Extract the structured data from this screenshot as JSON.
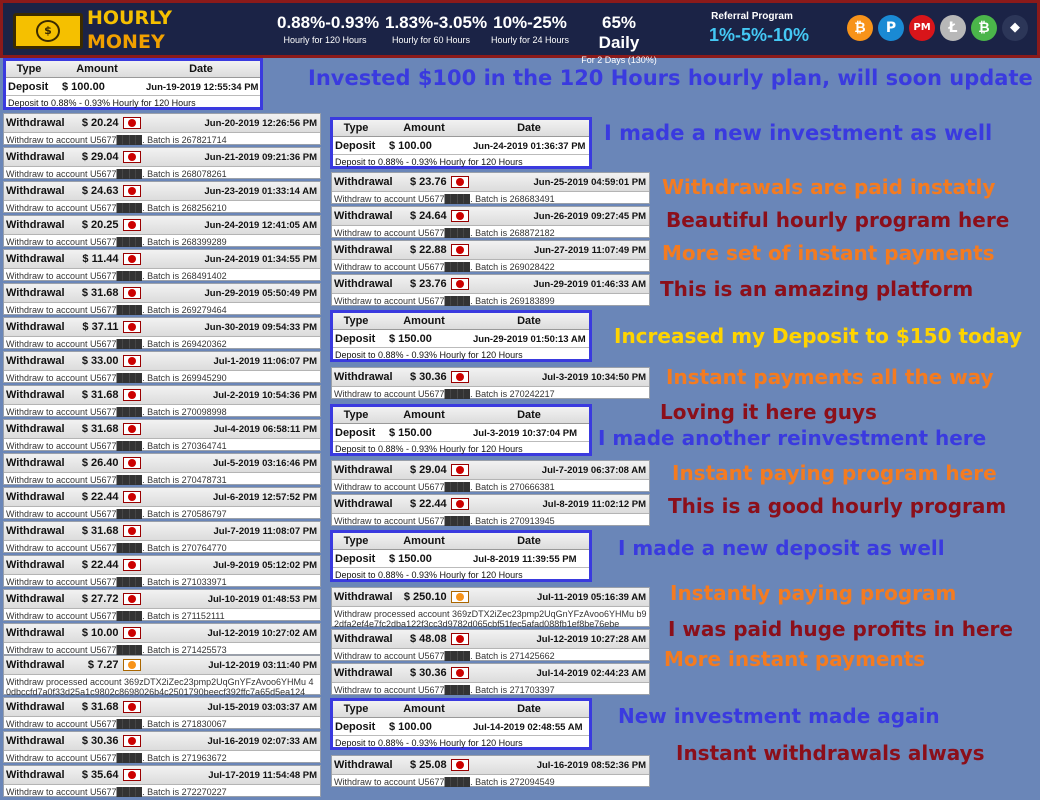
{
  "header": {
    "logo_top": "HOURLY",
    "logo_bottom": "MONEY",
    "rates": [
      {
        "range": "0.88%-0.93%",
        "sub": "Hourly for 120 Hours"
      },
      {
        "range": "1.83%-3.05%",
        "sub": "Hourly for 60 Hours"
      },
      {
        "range": "10%-25%",
        "sub": "Hourly for 24 Hours"
      },
      {
        "range": "65% Daily",
        "sub": "For 2 Days (130%)"
      }
    ],
    "referral_title": "Referral Program",
    "referral_value": "1%-5%-10%",
    "payment_icons": [
      "bitcoin-icon",
      "paypal-icon",
      "perfectmoney-icon",
      "litecoin-icon",
      "bitcoincash-icon",
      "ethereum-icon"
    ]
  },
  "col_headers": {
    "type": "Type",
    "amount": "Amount",
    "date": "Date"
  },
  "left_deposit": {
    "type": "Deposit",
    "amount": "$ 100.00",
    "date": "Jun-19-2019 12:55:34 PM",
    "detail": "Deposit to 0.88% - 0.93% Hourly for 120 Hours"
  },
  "left_records": [
    {
      "type": "Withdrawal",
      "amount": "$ 20.24",
      "date": "Jun-20-2019 12:26:56 PM",
      "detail": "Withdraw to account U5677████. Batch is 267821714"
    },
    {
      "type": "Withdrawal",
      "amount": "$ 29.04",
      "date": "Jun-21-2019 09:21:36 PM",
      "detail": "Withdraw to account U5677████. Batch is 268078261"
    },
    {
      "type": "Withdrawal",
      "amount": "$ 24.63",
      "date": "Jun-23-2019 01:33:14 AM",
      "detail": "Withdraw to account U5677████. Batch is 268256210"
    },
    {
      "type": "Withdrawal",
      "amount": "$ 20.25",
      "date": "Jun-24-2019 12:41:05 AM",
      "detail": "Withdraw to account U5677████. Batch is 268399289"
    },
    {
      "type": "Withdrawal",
      "amount": "$ 11.44",
      "date": "Jun-24-2019 01:34:55 PM",
      "detail": "Withdraw to account U5677████. Batch is 268491402"
    },
    {
      "type": "Withdrawal",
      "amount": "$ 31.68",
      "date": "Jun-29-2019 05:50:49 PM",
      "detail": "Withdraw to account U5677████. Batch is 269279464"
    },
    {
      "type": "Withdrawal",
      "amount": "$ 37.11",
      "date": "Jun-30-2019 09:54:33 PM",
      "detail": "Withdraw to account U5677████. Batch is 269420362"
    },
    {
      "type": "Withdrawal",
      "amount": "$ 33.00",
      "date": "Jul-1-2019 11:06:07 PM",
      "detail": "Withdraw to account U5677████. Batch is 269945290"
    },
    {
      "type": "Withdrawal",
      "amount": "$ 31.68",
      "date": "Jul-2-2019 10:54:36 PM",
      "detail": "Withdraw to account U5677████. Batch is 270098998"
    },
    {
      "type": "Withdrawal",
      "amount": "$ 31.68",
      "date": "Jul-4-2019 06:58:11 PM",
      "detail": "Withdraw to account U5677████. Batch is 270364741"
    },
    {
      "type": "Withdrawal",
      "amount": "$ 26.40",
      "date": "Jul-5-2019 03:16:46 PM",
      "detail": "Withdraw to account U5677████. Batch is 270478731"
    },
    {
      "type": "Withdrawal",
      "amount": "$ 22.44",
      "date": "Jul-6-2019 12:57:52 PM",
      "detail": "Withdraw to account U5677████. Batch is 270586797"
    },
    {
      "type": "Withdrawal",
      "amount": "$ 31.68",
      "date": "Jul-7-2019 11:08:07 PM",
      "detail": "Withdraw to account U5677████. Batch is 270764770"
    },
    {
      "type": "Withdrawal",
      "amount": "$ 22.44",
      "date": "Jul-9-2019 05:12:02 PM",
      "detail": "Withdraw to account U5677████. Batch is 271033971"
    },
    {
      "type": "Withdrawal",
      "amount": "$ 27.72",
      "date": "Jul-10-2019 01:48:53 PM",
      "detail": "Withdraw to account U5677████. Batch is 271152111"
    },
    {
      "type": "Withdrawal",
      "amount": "$ 10.00",
      "date": "Jul-12-2019 10:27:02 AM",
      "detail": "Withdraw to account U5677████. Batch is 271425573"
    },
    {
      "type": "Withdrawal",
      "amount": "$ 7.27",
      "date": "Jul-12-2019 03:11:40 PM",
      "detail": "Withdraw processed account 369zDTX2iZec23pmp2UqGnYFzAvoo6YHMu 40dbccfd7a0f33d25a1c9802c8698026b4c2501790beecf392ffc7a65d5ea124",
      "btc": true
    },
    {
      "type": "Withdrawal",
      "amount": "$ 31.68",
      "date": "Jul-15-2019 03:03:37 AM",
      "detail": "Withdraw to account U5677████. Batch is 271830067"
    },
    {
      "type": "Withdrawal",
      "amount": "$ 30.36",
      "date": "Jul-16-2019 02:07:33 AM",
      "detail": "Withdraw to account U5677████. Batch is 271963672"
    },
    {
      "type": "Withdrawal",
      "amount": "$ 35.64",
      "date": "Jul-17-2019 11:54:48 PM",
      "detail": "Withdraw to account U5677████. Batch is 272270227"
    }
  ],
  "right_deposits": [
    {
      "type": "Deposit",
      "amount": "$ 100.00",
      "date": "Jun-24-2019 01:36:37 PM",
      "detail": "Deposit to 0.88% - 0.93% Hourly for 120 Hours"
    },
    {
      "type": "Deposit",
      "amount": "$ 150.00",
      "date": "Jun-29-2019 01:50:13 AM",
      "detail": "Deposit to 0.88% - 0.93% Hourly for 120 Hours"
    },
    {
      "type": "Deposit",
      "amount": "$ 150.00",
      "date": "Jul-3-2019 10:37:04 PM",
      "detail": "Deposit to 0.88% - 0.93% Hourly for 120 Hours"
    },
    {
      "type": "Deposit",
      "amount": "$ 150.00",
      "date": "Jul-8-2019 11:39:55 PM",
      "detail": "Deposit to 0.88% - 0.93% Hourly for 120 Hours"
    },
    {
      "type": "Deposit",
      "amount": "$ 100.00",
      "date": "Jul-14-2019 02:48:55 AM",
      "detail": "Deposit to 0.88% - 0.93% Hourly for 120 Hours"
    }
  ],
  "right_records": [
    {
      "type": "Withdrawal",
      "amount": "$ 23.76",
      "date": "Jun-25-2019 04:59:01 PM",
      "detail": "Withdraw to account U5677████. Batch is 268683491"
    },
    {
      "type": "Withdrawal",
      "amount": "$ 24.64",
      "date": "Jun-26-2019 09:27:45 PM",
      "detail": "Withdraw to account U5677████. Batch is 268872182"
    },
    {
      "type": "Withdrawal",
      "amount": "$ 22.88",
      "date": "Jun-27-2019 11:07:49 PM",
      "detail": "Withdraw to account U5677████. Batch is 269028422"
    },
    {
      "type": "Withdrawal",
      "amount": "$ 23.76",
      "date": "Jun-29-2019 01:46:33 AM",
      "detail": "Withdraw to account U5677████. Batch is 269183899"
    },
    {
      "type": "Withdrawal",
      "amount": "$ 30.36",
      "date": "Jul-3-2019 10:34:50 PM",
      "detail": "Withdraw to account U5677████. Batch is 270242217"
    },
    {
      "type": "Withdrawal",
      "amount": "$ 29.04",
      "date": "Jul-7-2019 06:37:08 AM",
      "detail": "Withdraw to account U5677████. Batch is 270666381"
    },
    {
      "type": "Withdrawal",
      "amount": "$ 22.44",
      "date": "Jul-8-2019 11:02:12 PM",
      "detail": "Withdraw to account U5677████. Batch is 270913945"
    },
    {
      "type": "Withdrawal",
      "amount": "$ 250.10",
      "date": "Jul-11-2019 05:16:39 AM",
      "detail": "Withdraw processed account 369zDTX2iZec23pmp2UqGnYFzAvoo6YHMu b92dfa2ef4e7fc2dba122f3cc3d9782d065cbf51fec5afad088fb1ef8be76ebe",
      "btc": true
    },
    {
      "type": "Withdrawal",
      "amount": "$ 48.08",
      "date": "Jul-12-2019 10:27:28 AM",
      "detail": "Withdraw to account U5677████. Batch is 271425662"
    },
    {
      "type": "Withdrawal",
      "amount": "$ 30.36",
      "date": "Jul-14-2019 02:44:23 AM",
      "detail": "Withdraw to account U5677████. Batch is 271703397"
    },
    {
      "type": "Withdrawal",
      "amount": "$ 25.08",
      "date": "Jul-16-2019 08:52:36 PM",
      "detail": "Withdraw to account U5677████. Batch is 272094549"
    }
  ],
  "captions": [
    {
      "text": "Invested $100 in the 120 Hours hourly plan, will soon update",
      "color": "#3a3adf"
    },
    {
      "text": "I made a new investment as well",
      "color": "#3a3adf"
    },
    {
      "text": "Withdrawals are paid instatly",
      "color": "#f47b20"
    },
    {
      "text": "Beautiful hourly program here",
      "color": "#8b0f1a"
    },
    {
      "text": "More set of instant payments",
      "color": "#f47b20"
    },
    {
      "text": "This is an amazing platform",
      "color": "#8b0f1a"
    },
    {
      "text": "Increased my Deposit to $150 today",
      "color": "#ffd400"
    },
    {
      "text": "Instant payments all the way",
      "color": "#f47b20"
    },
    {
      "text": "Loving it here guys",
      "color": "#8b0f1a"
    },
    {
      "text": "I made another reinvestment here",
      "color": "#3a3adf"
    },
    {
      "text": "Instant paying program here",
      "color": "#f47b20"
    },
    {
      "text": "This is a good hourly program",
      "color": "#8b0f1a"
    },
    {
      "text": "I made a new deposit as well",
      "color": "#3a3adf"
    },
    {
      "text": "Instantly paying program",
      "color": "#f47b20"
    },
    {
      "text": "I was paid huge profits in here",
      "color": "#8b0f1a"
    },
    {
      "text": "More instant payments",
      "color": "#f47b20"
    },
    {
      "text": "New investment made again",
      "color": "#3a3adf"
    },
    {
      "text": "Instant withdrawals always",
      "color": "#8b0f1a"
    }
  ]
}
